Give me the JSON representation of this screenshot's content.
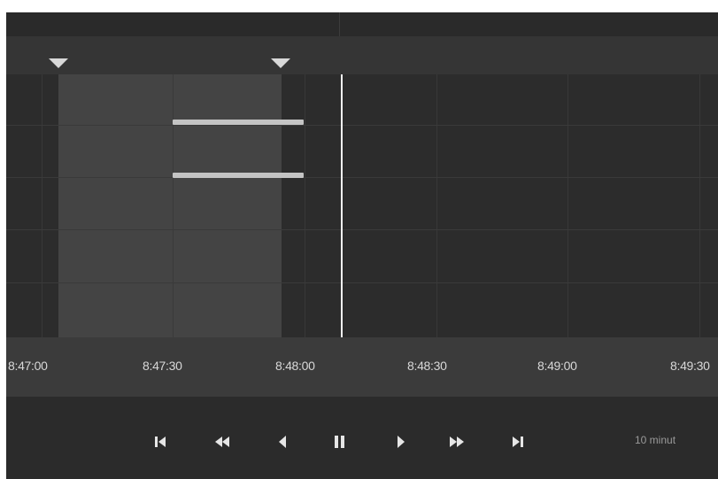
{
  "timeline": {
    "tick_labels": [
      "8:47:00",
      "8:47:30",
      "8:48:00",
      "8:48:30",
      "8:49:00",
      "8:49:30"
    ]
  },
  "controls": {
    "speed_label": "10 minut",
    "icons": [
      "skip-to-start-icon",
      "rewind-icon",
      "step-back-icon",
      "pause-icon",
      "play-icon",
      "fast-forward-icon",
      "skip-to-end-icon"
    ]
  },
  "colors": {
    "background": "#2b2b2b",
    "selection": "#444444",
    "event_bar": "#c4c4c4",
    "playhead": "#f2f2f2",
    "tick_text": "#d8d8d8"
  }
}
